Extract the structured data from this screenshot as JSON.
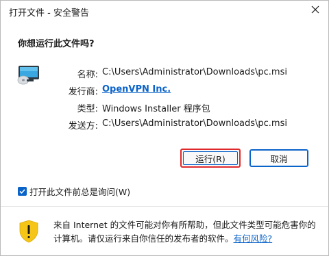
{
  "window": {
    "title": "打开文件 - 安全警告"
  },
  "dialog": {
    "question": "你想运行此文件吗?",
    "icon": "msi-installer-icon",
    "fields": [
      {
        "label": "名称:",
        "value": "C:\\Users\\Administrator\\Downloads\\pc.msi",
        "is_link": false
      },
      {
        "label": "发行商:",
        "value": "OpenVPN Inc.",
        "is_link": true
      },
      {
        "label": "类型:",
        "value": "Windows Installer 程序包",
        "is_link": false
      },
      {
        "label": "发送方:",
        "value": "C:\\Users\\Administrator\\Downloads\\pc.msi",
        "is_link": false
      }
    ],
    "run_button": "运行(R)",
    "cancel_button": "取消",
    "checkbox_label": "打开此文件前总是询问(W)",
    "checkbox_checked": true
  },
  "footer": {
    "warning_text": "来自 Internet 的文件可能对你有所帮助，但此文件类型可能危害你的计算机。请仅运行来自你信任的发布者的软件。",
    "risk_link": "有何风险?"
  },
  "colors": {
    "accent": "#0a63c9",
    "highlight": "#e0292b",
    "shield": "#f5c518"
  }
}
